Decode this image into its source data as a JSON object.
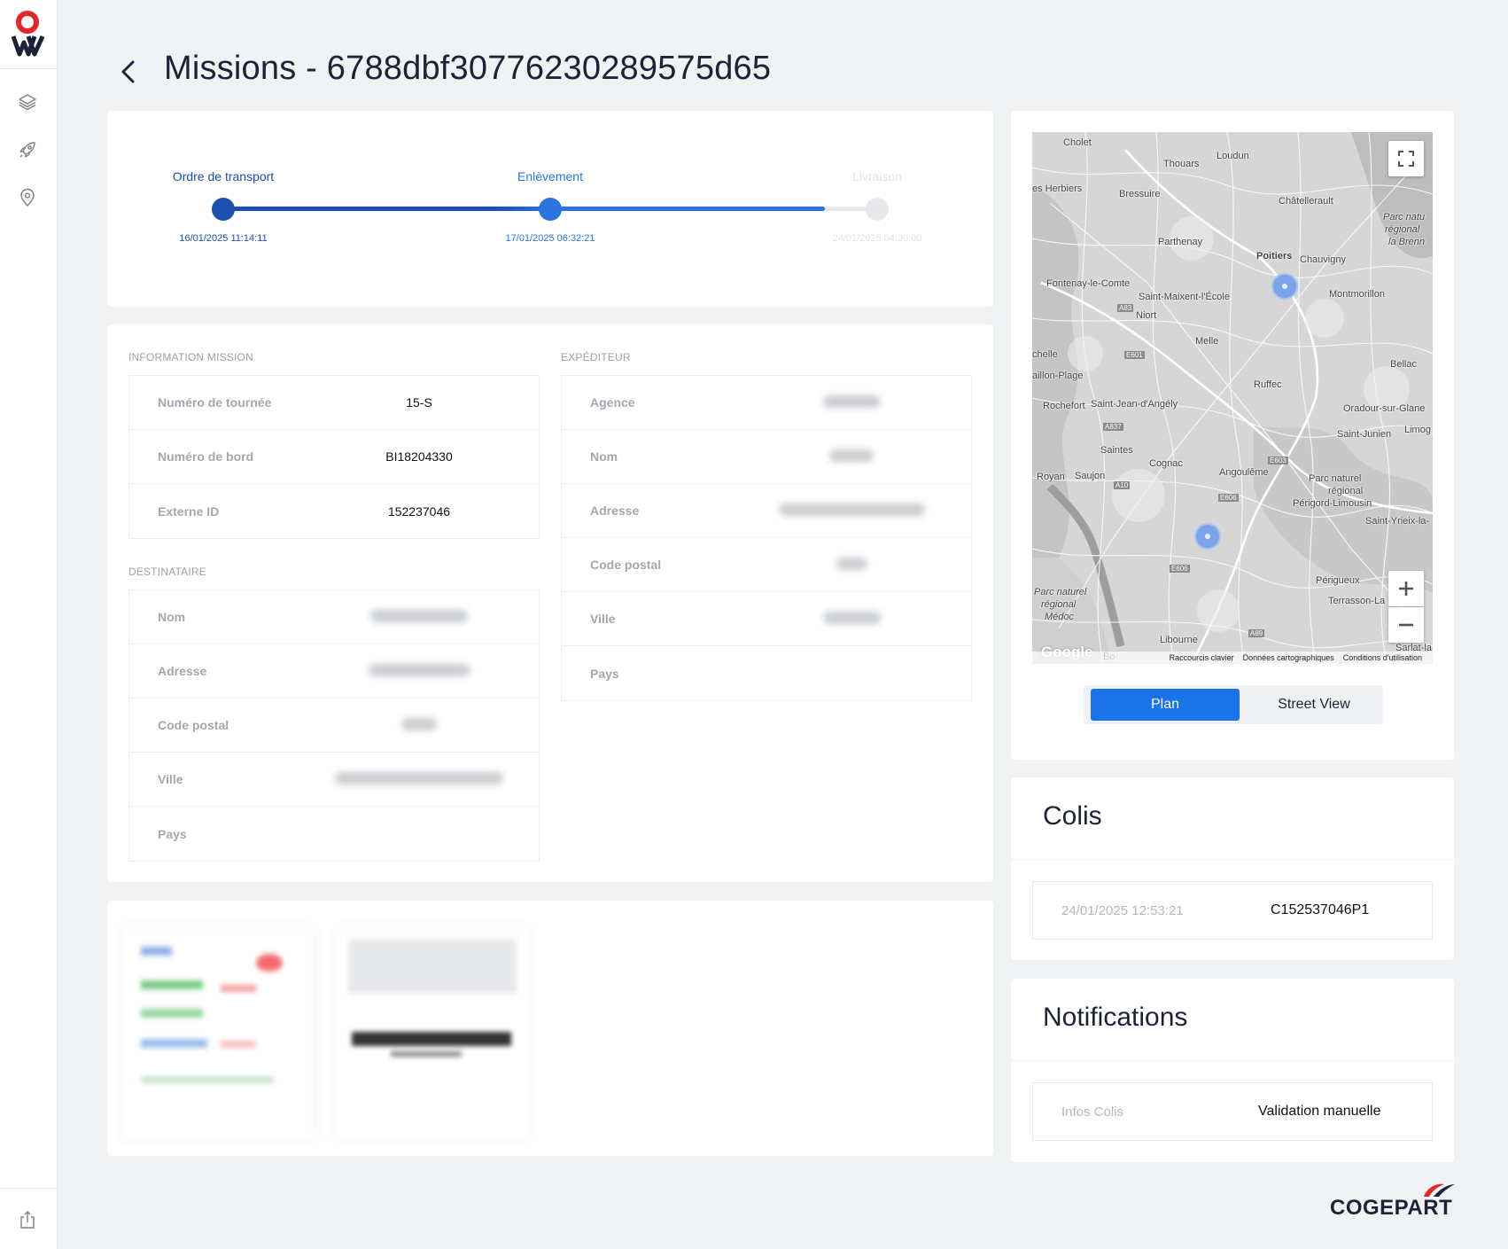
{
  "header": {
    "title": "Missions - 6788dbf30776230289575d65"
  },
  "sidebar": {
    "items": [
      {
        "name": "layers-icon"
      },
      {
        "name": "rocket-icon"
      },
      {
        "name": "location-pin-icon"
      }
    ],
    "bottom": {
      "name": "export-icon"
    }
  },
  "stepper": {
    "steps": [
      {
        "label": "Ordre de transport",
        "date": "16/01/2025 11:14:11",
        "status": "done"
      },
      {
        "label": "Enlèvement",
        "date": "17/01/2025 06:32:21",
        "status": "current"
      },
      {
        "label": "Livraison",
        "date": "24/01/2025 04:30:00",
        "status": "pending"
      }
    ],
    "progress_fraction": 0.92,
    "colors": {
      "done": "#1d4fb1",
      "current": "#2a74e0",
      "pending": "#e6e8eb"
    }
  },
  "mission": {
    "section_label": "INFORMATION MISSION",
    "rows": [
      {
        "key": "Numéro de tournée",
        "value": "15-S"
      },
      {
        "key": "Numéro de bord",
        "value": "BI18204330"
      },
      {
        "key": "Externe ID",
        "value": "152237046"
      }
    ]
  },
  "destinataire": {
    "section_label": "DESTINATAIRE",
    "rows": [
      {
        "key": "Nom",
        "value": ""
      },
      {
        "key": "Adresse",
        "value": ""
      },
      {
        "key": "Code postal",
        "value": ""
      },
      {
        "key": "Ville",
        "value": ""
      },
      {
        "key": "Pays",
        "value": ""
      }
    ]
  },
  "expediteur": {
    "section_label": "EXPÉDITEUR",
    "rows": [
      {
        "key": "Agence",
        "value": ""
      },
      {
        "key": "Nom",
        "value": ""
      },
      {
        "key": "Adresse",
        "value": ""
      },
      {
        "key": "Code postal",
        "value": ""
      },
      {
        "key": "Ville",
        "value": ""
      },
      {
        "key": "Pays",
        "value": ""
      }
    ]
  },
  "map": {
    "places": [
      "Cholet",
      "Loudun",
      "Thouars",
      "es Herbiers",
      "Bressuire",
      "Châtellerault",
      "Parc natu",
      "régional",
      "la Brenn",
      "Parthenay",
      "Poitiers",
      "Chauvigny",
      "Fontenay-le-Comte",
      "Saint-Maixent-l'École",
      "Montmorillon",
      "Niort",
      "Melle",
      "chelle",
      "Bellac",
      "aillon-Plage",
      "Ruffec",
      "Rochefort",
      "Saint-Jean-d'Angély",
      "Oradour-sur-Glane",
      "Saint-Junien",
      "Limog",
      "Saintes",
      "Cognac",
      "Angoulême",
      "Royan",
      "Saujon",
      "Parc naturel",
      "régional",
      "Périgord-Limousin",
      "Saint-Yrieix-la-",
      "Périgueux",
      "Terrasson-La",
      "Parc naturel",
      "régional",
      "Médoc",
      "Libourne",
      "Sarlat-la-Ca",
      "Bo"
    ],
    "roads": [
      "A83",
      "E601",
      "A837",
      "A10",
      "E603",
      "E606",
      "E606",
      "A89"
    ],
    "footer": {
      "keyboard": "Raccourcis clavier",
      "data": "Données cartographiques",
      "terms": "Conditions d'utilisation"
    },
    "logo": "Google",
    "toggle": {
      "plan": "Plan",
      "street": "Street View",
      "active": "plan"
    },
    "accent": "#1a73e8"
  },
  "colis": {
    "title": "Colis",
    "row": {
      "date": "24/01/2025 12:53:21",
      "code": "C152537046P1"
    }
  },
  "notifications": {
    "title": "Notifications",
    "row": {
      "type": "Infos Colis",
      "value": "Validation manuelle"
    }
  },
  "brand": {
    "name": "COGEPART",
    "accent": "#e2262b",
    "dark": "#1c2238"
  }
}
